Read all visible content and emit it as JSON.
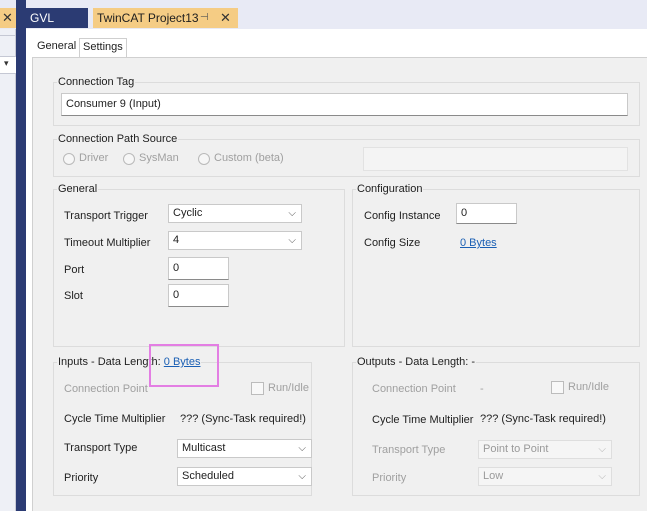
{
  "left_tab": {
    "close_glyph": "✕"
  },
  "left_panel": {
    "dropdown_glyph": "▾"
  },
  "tabs": [
    {
      "label": "GVL"
    },
    {
      "label": "TwinCAT Project13",
      "pin_glyph": "⊣",
      "close_glyph": "✕"
    }
  ],
  "subtabs": [
    {
      "label": "General"
    },
    {
      "label": "Settings"
    }
  ],
  "connection_tag": {
    "legend": "Connection Tag",
    "value": "Consumer 9 (Input)"
  },
  "connection_path_source": {
    "legend": "Connection Path Source",
    "options": [
      {
        "label": "Driver"
      },
      {
        "label": "SysMan"
      },
      {
        "label": "Custom (beta)"
      }
    ]
  },
  "general": {
    "legend": "General",
    "transport_trigger": {
      "label": "Transport Trigger",
      "value": "Cyclic"
    },
    "timeout_multiplier": {
      "label": "Timeout Multiplier",
      "value": "4"
    },
    "port": {
      "label": "Port",
      "value": "0"
    },
    "slot": {
      "label": "Slot",
      "value": "0"
    }
  },
  "configuration": {
    "legend": "Configuration",
    "config_instance": {
      "label": "Config Instance",
      "value": "0"
    },
    "config_size": {
      "label": "Config Size",
      "value": "0 Bytes"
    }
  },
  "inputs": {
    "legend": "Inputs - Data Length: ",
    "data_length_link": "0 Bytes",
    "connection_point": {
      "label": "Connection Point"
    },
    "run_idle": "Run/Idle",
    "cycle_time_multiplier": {
      "label": "Cycle Time Multiplier",
      "value": "??? (Sync-Task required!)"
    },
    "transport_type": {
      "label": "Transport Type",
      "value": "Multicast"
    },
    "priority": {
      "label": "Priority",
      "value": "Scheduled"
    }
  },
  "outputs": {
    "legend": "Outputs - Data Length: -",
    "connection_point": {
      "label": "Connection Point",
      "value": "-"
    },
    "run_idle": "Run/Idle",
    "cycle_time_multiplier": {
      "label": "Cycle Time Multiplier",
      "value": "??? (Sync-Task required!)"
    },
    "transport_type": {
      "label": "Transport Type",
      "value": "Point to Point"
    },
    "priority": {
      "label": "Priority",
      "value": "Low"
    }
  },
  "ui": {
    "chevron": "⌵"
  },
  "colors": {
    "accent_dark": "#2b3b73",
    "active_tab": "#f5cc84",
    "link": "#1a5fb4",
    "highlight": "#e37ee3"
  }
}
